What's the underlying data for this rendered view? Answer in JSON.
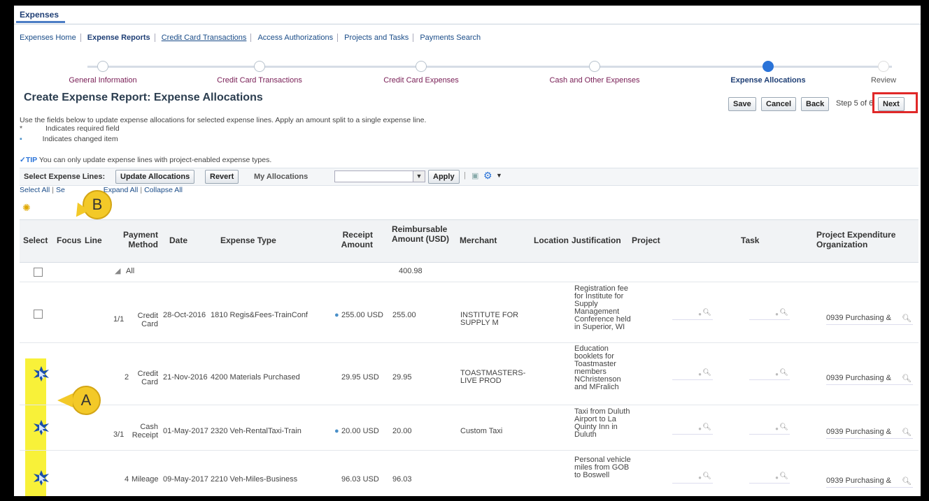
{
  "app": {
    "tab": "Expenses"
  },
  "subnav": [
    {
      "label": "Expenses Home"
    },
    {
      "label": "Expense Reports"
    },
    {
      "label": "Credit Card Transactions"
    },
    {
      "label": "Access Authorizations"
    },
    {
      "label": "Projects and Tasks"
    },
    {
      "label": "Payments Search"
    }
  ],
  "train": [
    {
      "label": "General Information"
    },
    {
      "label": "Credit Card Transactions"
    },
    {
      "label": "Credit Card Expenses"
    },
    {
      "label": "Cash and Other Expenses"
    },
    {
      "label": "Expense Allocations"
    },
    {
      "label": "Review"
    }
  ],
  "page": {
    "title": "Create Expense Report: Expense Allocations",
    "instructions": "Use the fields below to update expense allocations for selected expense lines. Apply an amount split to a single expense line.",
    "required_legend": "Indicates required field",
    "changed_legend": "Indicates changed item",
    "tip_label": "TIP",
    "tip_text": "You can only update expense lines with project-enabled expense types."
  },
  "actions": {
    "save": "Save",
    "cancel": "Cancel",
    "back": "Back",
    "step": "Step 5 of 6",
    "next": "Next"
  },
  "toolbar": {
    "select_lines_label": "Select Expense Lines:",
    "update_allocations": "Update Allocations",
    "revert": "Revert",
    "my_allocations_label": "My Allocations",
    "apply": "Apply"
  },
  "selection_links": {
    "select_all": "Select All",
    "select_none": "Se",
    "expand_all": "Expand All",
    "collapse_all": "Collapse All"
  },
  "callouts": {
    "a": "A",
    "b": "B"
  },
  "table": {
    "headers": {
      "select": "Select",
      "focus": "Focus",
      "line": "Line",
      "payment_method": "Payment Method",
      "date": "Date",
      "expense_type": "Expense Type",
      "receipt_amount": "Receipt Amount",
      "reimbursable": "Reimbursable Amount (USD)",
      "merchant": "Merchant",
      "location": "Location",
      "justification": "Justification",
      "project": "Project",
      "task": "Task",
      "org": "Project Expenditure Organization"
    },
    "all_row": {
      "label": "All",
      "total": "400.98"
    },
    "rows": [
      {
        "line": "1/1",
        "payment": "Credit Card",
        "date": "28-Oct-2016",
        "type": "1810 Regis&Fees-TrainConf",
        "receipt": "255.00 USD",
        "reimb": "255.00",
        "merchant": "INSTITUTE FOR SUPPLY M",
        "justification": "Registration fee for Institute for Supply Management Conference held in Superior, WI",
        "org": "0939 Purchasing &"
      },
      {
        "line": "2",
        "payment": "Credit Card",
        "date": "21-Nov-2016",
        "type": "4200 Materials Purchased",
        "receipt": "29.95 USD",
        "reimb": "29.95",
        "merchant": "TOASTMASTERS-LIVE PROD",
        "justification": "Education booklets for Toastmaster members NChristenson and MFralich",
        "org": "0939 Purchasing &"
      },
      {
        "line": "3/1",
        "payment": "Cash Receipt",
        "date": "01-May-2017",
        "type": "2320 Veh-RentalTaxi-Train",
        "receipt": "20.00 USD",
        "reimb": "20.00",
        "merchant": "Custom Taxi",
        "justification": "Taxi from Duluth Airport to La Quinty Inn in Duluth",
        "org": "0939 Purchasing &"
      },
      {
        "line": "4",
        "payment": "Mileage",
        "date": "09-May-2017",
        "type": "2210 Veh-Miles-Business",
        "receipt": "96.03 USD",
        "reimb": "96.03",
        "merchant": "",
        "justification": "Personal vehicle miles from GOB to Boswell",
        "org": "0939 Purchasing &"
      }
    ]
  }
}
